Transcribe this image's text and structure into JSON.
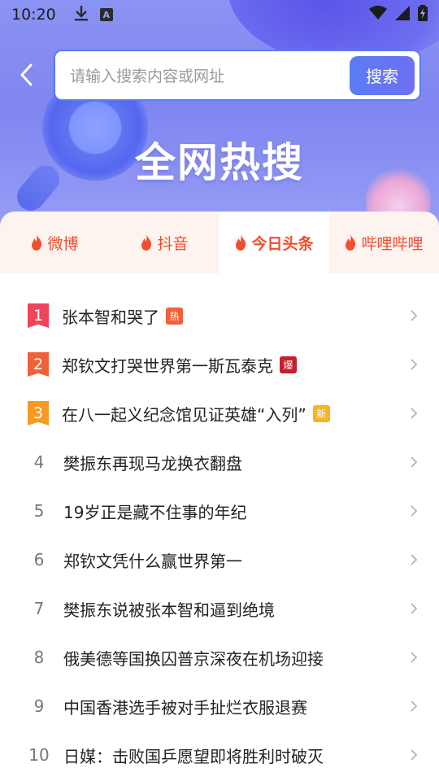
{
  "status_bar": {
    "time": "10:20",
    "left_icons": [
      "download-icon",
      "keyboard-a-icon"
    ],
    "right_icons": [
      "wifi-icon",
      "signal-icon",
      "battery-icon"
    ]
  },
  "search": {
    "placeholder": "请输入搜索内容或网址",
    "button_label": "搜索"
  },
  "hero": {
    "title": "全网热搜"
  },
  "tabs": [
    {
      "label": "微博",
      "active": false
    },
    {
      "label": "抖音",
      "active": false
    },
    {
      "label": "今日头条",
      "active": true
    },
    {
      "label": "哔哩哔哩",
      "active": false
    }
  ],
  "list": [
    {
      "rank": "1",
      "title": "张本智和哭了",
      "badge": "热"
    },
    {
      "rank": "2",
      "title": "郑钦文打哭世界第一斯瓦泰克",
      "badge": "爆"
    },
    {
      "rank": "3",
      "title": "在八一起义纪念馆见证英雄“入列”",
      "badge": "新"
    },
    {
      "rank": "4",
      "title": "樊振东再现马龙换衣翻盘",
      "badge": ""
    },
    {
      "rank": "5",
      "title": "19岁正是藏不住事的年纪",
      "badge": ""
    },
    {
      "rank": "6",
      "title": "郑钦文凭什么赢世界第一",
      "badge": ""
    },
    {
      "rank": "7",
      "title": "樊振东说被张本智和逼到绝境",
      "badge": ""
    },
    {
      "rank": "8",
      "title": "俄美德等国换囚普京深夜在机场迎接",
      "badge": ""
    },
    {
      "rank": "9",
      "title": "中国香港选手被对手扯烂衣服退赛",
      "badge": ""
    },
    {
      "rank": "10",
      "title": "日媒：击败国乒愿望即将胜利时破灭",
      "badge": ""
    }
  ],
  "colors": {
    "accent": "#f04e2f",
    "search_border": "#5b79f2",
    "hero_gradient": "#8a93f3"
  }
}
